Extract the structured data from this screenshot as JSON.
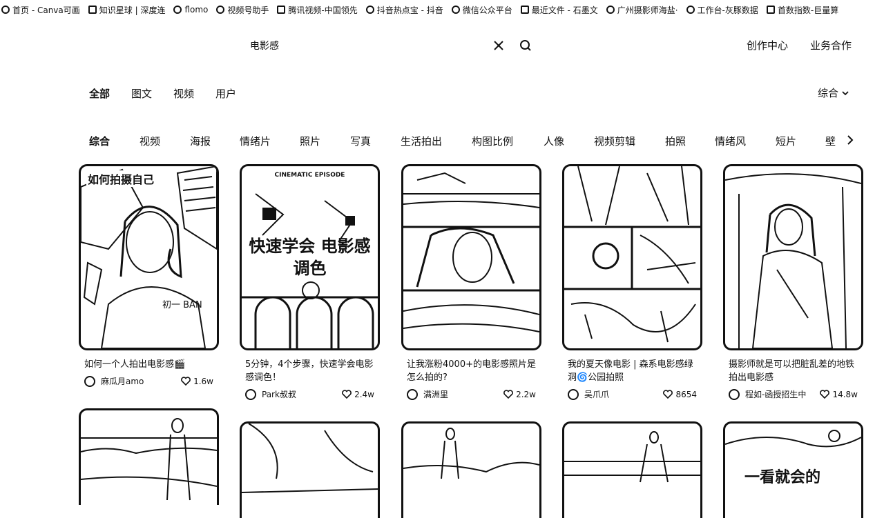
{
  "bookmarks": [
    {
      "label": "首页 - Canva可画",
      "icon": "canva-icon"
    },
    {
      "label": "知识星球 | 深度连",
      "icon": "zsxq-icon"
    },
    {
      "label": "flomo",
      "icon": "flomo-icon"
    },
    {
      "label": "视频号助手",
      "icon": "wechat-channels-icon"
    },
    {
      "label": "腾讯视频-中国领先",
      "icon": "tencent-video-icon"
    },
    {
      "label": "抖音热点宝 - 抖音",
      "icon": "douyin-icon"
    },
    {
      "label": "微信公众平台",
      "icon": "wechat-icon"
    },
    {
      "label": "最近文件 - 石墨文",
      "icon": "shimo-icon"
    },
    {
      "label": "广州摄影师海盐·",
      "icon": "bookmark-icon"
    },
    {
      "label": "工作台-灰豚数据",
      "icon": "huitun-icon"
    },
    {
      "label": "首数指数-巨量算",
      "icon": "juliang-icon"
    }
  ],
  "header": {
    "search_query": "电影感",
    "links": [
      "创作中心",
      "业务合作"
    ]
  },
  "type_tabs": [
    "全部",
    "图文",
    "视频",
    "用户"
  ],
  "sort_label": "综合",
  "chips": [
    "综合",
    "视频",
    "海报",
    "情绪片",
    "照片",
    "写真",
    "生活拍出",
    "构图比例",
    "人像",
    "视频剪辑",
    "拍照",
    "情绪风",
    "短片",
    "壁"
  ],
  "cards": [
    {
      "title": "如何一个人拍出电影感🎬",
      "author": "麻瓜月amo",
      "likes": "1.6w",
      "cover_text": "如何拍摄自己"
    },
    {
      "title": "5分钟，4个步骤，快速学会电影感调色！",
      "author": "Park叔叔",
      "likes": "2.4w",
      "cover_text": "快速学会 电影感调色",
      "cover_top": "CINEMATIC EPISODE"
    },
    {
      "title": "让我涨粉4000+的电影感照片是怎么拍的?",
      "author": "满洲里",
      "likes": "2.2w"
    },
    {
      "title": "我的夏天像电影 | 森系电影感绿洞🌀公园拍照",
      "author": "吴爪爪",
      "likes": "8654"
    },
    {
      "title": "摄影师就是可以把脏乱差的地铁拍出电影感",
      "author": "程如-函授招生中",
      "likes": "14.8w"
    }
  ],
  "row2_cover_text": "一看就会的"
}
